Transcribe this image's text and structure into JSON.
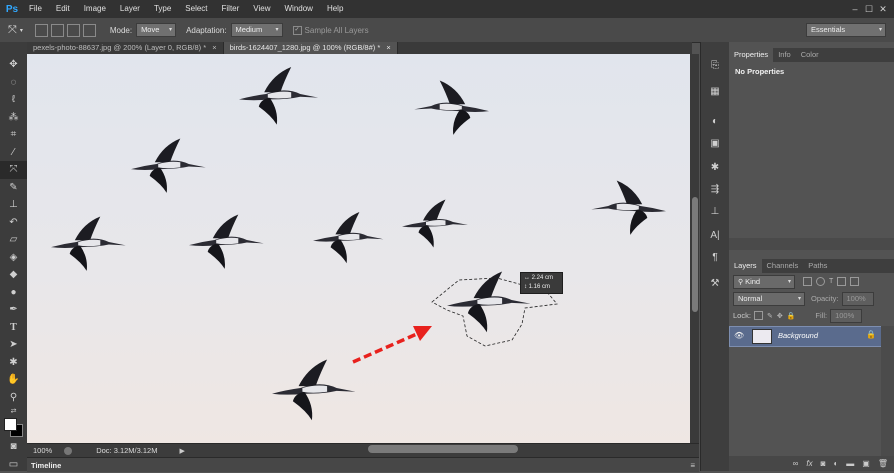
{
  "app": {
    "logo": "Ps"
  },
  "menu": [
    "File",
    "Edit",
    "Image",
    "Layer",
    "Type",
    "Select",
    "Filter",
    "View",
    "Window",
    "Help"
  ],
  "window_controls": {
    "minimize": "–",
    "maximize": "☐",
    "close": "✕"
  },
  "options": {
    "mode_label": "Mode:",
    "mode_value": "Move",
    "adaptation_label": "Adaptation:",
    "adaptation_value": "Medium",
    "sample_all_layers": "Sample All Layers",
    "sample_checked": true,
    "workspace": "Essentials"
  },
  "tabs": [
    {
      "label": "pexels-photo-88637.jpg @ 200% (Layer 0, RGB/8) *",
      "close": "×",
      "active": false
    },
    {
      "label": "birds-1624407_1280.jpg @ 100% (RGB/8#) *",
      "close": "×",
      "active": true
    }
  ],
  "measure": {
    "w": "2.24 cm",
    "h": "1.16 cm",
    "w_icon": "↔",
    "h_icon": "↕"
  },
  "status": {
    "zoom": "100%",
    "doc": "Doc: 3.12M/3.12M"
  },
  "timeline": {
    "label": "Timeline"
  },
  "panels": {
    "top_tabs": [
      "Properties",
      "Info",
      "Color"
    ],
    "properties_text": "No Properties",
    "layer_tabs": [
      "Layers",
      "Channels",
      "Paths"
    ],
    "kind_label": "Kind",
    "blend_mode": "Normal",
    "opacity_label": "Opacity:",
    "opacity_value": "100%",
    "lock_label": "Lock:",
    "fill_label": "Fill:",
    "fill_value": "100%",
    "layer_name": "Background"
  },
  "colors": {
    "accent": "#31a8ff",
    "arrow": "#e8211d",
    "selected_layer": "#5a6b8d"
  }
}
